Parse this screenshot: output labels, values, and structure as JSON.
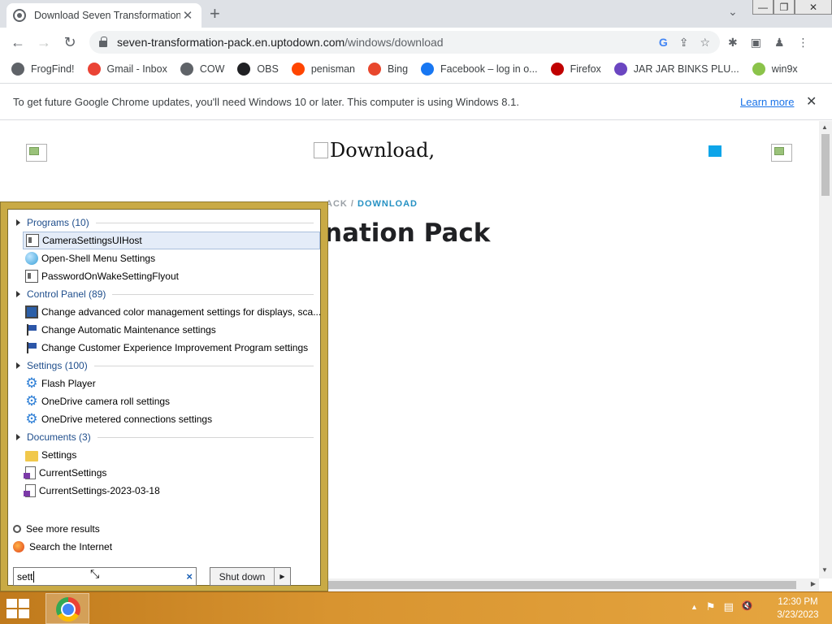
{
  "browser": {
    "tab_title": "Download Seven Transformation",
    "tab_close": "✕",
    "new_tab": "+",
    "tab_search": "⌄",
    "window_controls": {
      "minimize": "—",
      "restore": "❐",
      "close": "✕"
    },
    "url_domain": "seven-transformation-pack.en.uptodown.com",
    "url_path": "/windows/download",
    "omnibox_icons": [
      "G",
      "⇪",
      "☆"
    ],
    "toolbar_icons": [
      "✱",
      "▣",
      "♟",
      "⋮"
    ]
  },
  "bookmarks": [
    {
      "label": "FrogFind!",
      "color": "#5f6368"
    },
    {
      "label": "Gmail - Inbox",
      "color": "#ea4335"
    },
    {
      "label": "COW",
      "color": "#5f6368"
    },
    {
      "label": "OBS",
      "color": "#202124"
    },
    {
      "label": "penisman",
      "color": "#ff4500"
    },
    {
      "label": "Bing",
      "color": "#e8472d"
    },
    {
      "label": "Facebook – log in o...",
      "color": "#1877f2"
    },
    {
      "label": "Firefox",
      "color": "#c00000"
    },
    {
      "label": "JAR JAR BINKS PLU...",
      "color": "#6b46c1"
    },
    {
      "label": "win9x",
      "color": "#8bc34a"
    }
  ],
  "infobar": {
    "message": "To get future Google Chrome updates, you'll need Windows 10 or later. This computer is using Windows 8.1.",
    "link": "Learn more",
    "close": "✕"
  },
  "page": {
    "image_alt": "Download,",
    "breadcrumb_prefix": "ACK  /  ",
    "breadcrumb_current": "DOWNLOAD",
    "title_fragment": "nation Pack"
  },
  "start_menu": {
    "groups": [
      {
        "label": "Programs (10)"
      },
      {
        "label": "Control Panel (89)"
      },
      {
        "label": "Settings (100)"
      },
      {
        "label": "Documents (3)"
      }
    ],
    "programs": [
      "CameraSettingsUIHost",
      "Open-Shell Menu Settings",
      "PasswordOnWakeSettingFlyout"
    ],
    "control_panel": [
      "Change advanced color management settings for displays, sca...",
      "Change Automatic Maintenance settings",
      "Change Customer Experience Improvement Program settings"
    ],
    "settings": [
      "Flash Player",
      "OneDrive camera roll settings",
      "OneDrive metered connections settings"
    ],
    "documents": [
      "Settings",
      "CurrentSettings",
      "CurrentSettings-2023-03-18"
    ],
    "see_more": "See more results",
    "search_internet": "Search the Internet",
    "search_value": "sett",
    "search_clear": "×",
    "shutdown_label": "Shut down",
    "shutdown_arrow": "▶"
  },
  "taskbar": {
    "tray_icons": [
      "▲",
      "⚑",
      "▤",
      "🔇"
    ],
    "time": "12:30 PM",
    "date": "3/23/2023"
  }
}
